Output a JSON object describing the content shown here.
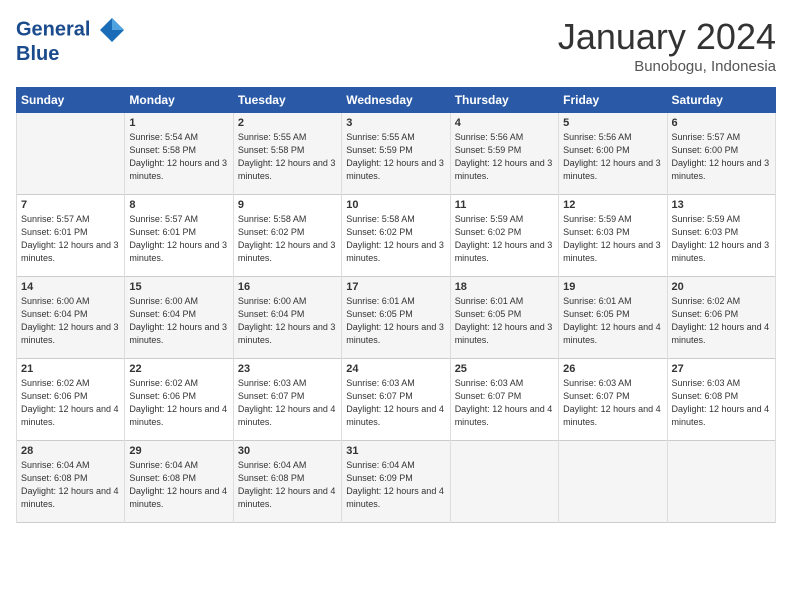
{
  "logo": {
    "line1": "General",
    "line2": "Blue"
  },
  "title": "January 2024",
  "location": "Bunobogu, Indonesia",
  "days_header": [
    "Sunday",
    "Monday",
    "Tuesday",
    "Wednesday",
    "Thursday",
    "Friday",
    "Saturday"
  ],
  "weeks": [
    [
      {
        "day": "",
        "sunrise": "",
        "sunset": "",
        "daylight": ""
      },
      {
        "day": "1",
        "sunrise": "Sunrise: 5:54 AM",
        "sunset": "Sunset: 5:58 PM",
        "daylight": "Daylight: 12 hours and 3 minutes."
      },
      {
        "day": "2",
        "sunrise": "Sunrise: 5:55 AM",
        "sunset": "Sunset: 5:58 PM",
        "daylight": "Daylight: 12 hours and 3 minutes."
      },
      {
        "day": "3",
        "sunrise": "Sunrise: 5:55 AM",
        "sunset": "Sunset: 5:59 PM",
        "daylight": "Daylight: 12 hours and 3 minutes."
      },
      {
        "day": "4",
        "sunrise": "Sunrise: 5:56 AM",
        "sunset": "Sunset: 5:59 PM",
        "daylight": "Daylight: 12 hours and 3 minutes."
      },
      {
        "day": "5",
        "sunrise": "Sunrise: 5:56 AM",
        "sunset": "Sunset: 6:00 PM",
        "daylight": "Daylight: 12 hours and 3 minutes."
      },
      {
        "day": "6",
        "sunrise": "Sunrise: 5:57 AM",
        "sunset": "Sunset: 6:00 PM",
        "daylight": "Daylight: 12 hours and 3 minutes."
      }
    ],
    [
      {
        "day": "7",
        "sunrise": "Sunrise: 5:57 AM",
        "sunset": "Sunset: 6:01 PM",
        "daylight": "Daylight: 12 hours and 3 minutes."
      },
      {
        "day": "8",
        "sunrise": "Sunrise: 5:57 AM",
        "sunset": "Sunset: 6:01 PM",
        "daylight": "Daylight: 12 hours and 3 minutes."
      },
      {
        "day": "9",
        "sunrise": "Sunrise: 5:58 AM",
        "sunset": "Sunset: 6:02 PM",
        "daylight": "Daylight: 12 hours and 3 minutes."
      },
      {
        "day": "10",
        "sunrise": "Sunrise: 5:58 AM",
        "sunset": "Sunset: 6:02 PM",
        "daylight": "Daylight: 12 hours and 3 minutes."
      },
      {
        "day": "11",
        "sunrise": "Sunrise: 5:59 AM",
        "sunset": "Sunset: 6:02 PM",
        "daylight": "Daylight: 12 hours and 3 minutes."
      },
      {
        "day": "12",
        "sunrise": "Sunrise: 5:59 AM",
        "sunset": "Sunset: 6:03 PM",
        "daylight": "Daylight: 12 hours and 3 minutes."
      },
      {
        "day": "13",
        "sunrise": "Sunrise: 5:59 AM",
        "sunset": "Sunset: 6:03 PM",
        "daylight": "Daylight: 12 hours and 3 minutes."
      }
    ],
    [
      {
        "day": "14",
        "sunrise": "Sunrise: 6:00 AM",
        "sunset": "Sunset: 6:04 PM",
        "daylight": "Daylight: 12 hours and 3 minutes."
      },
      {
        "day": "15",
        "sunrise": "Sunrise: 6:00 AM",
        "sunset": "Sunset: 6:04 PM",
        "daylight": "Daylight: 12 hours and 3 minutes."
      },
      {
        "day": "16",
        "sunrise": "Sunrise: 6:00 AM",
        "sunset": "Sunset: 6:04 PM",
        "daylight": "Daylight: 12 hours and 3 minutes."
      },
      {
        "day": "17",
        "sunrise": "Sunrise: 6:01 AM",
        "sunset": "Sunset: 6:05 PM",
        "daylight": "Daylight: 12 hours and 3 minutes."
      },
      {
        "day": "18",
        "sunrise": "Sunrise: 6:01 AM",
        "sunset": "Sunset: 6:05 PM",
        "daylight": "Daylight: 12 hours and 3 minutes."
      },
      {
        "day": "19",
        "sunrise": "Sunrise: 6:01 AM",
        "sunset": "Sunset: 6:05 PM",
        "daylight": "Daylight: 12 hours and 4 minutes."
      },
      {
        "day": "20",
        "sunrise": "Sunrise: 6:02 AM",
        "sunset": "Sunset: 6:06 PM",
        "daylight": "Daylight: 12 hours and 4 minutes."
      }
    ],
    [
      {
        "day": "21",
        "sunrise": "Sunrise: 6:02 AM",
        "sunset": "Sunset: 6:06 PM",
        "daylight": "Daylight: 12 hours and 4 minutes."
      },
      {
        "day": "22",
        "sunrise": "Sunrise: 6:02 AM",
        "sunset": "Sunset: 6:06 PM",
        "daylight": "Daylight: 12 hours and 4 minutes."
      },
      {
        "day": "23",
        "sunrise": "Sunrise: 6:03 AM",
        "sunset": "Sunset: 6:07 PM",
        "daylight": "Daylight: 12 hours and 4 minutes."
      },
      {
        "day": "24",
        "sunrise": "Sunrise: 6:03 AM",
        "sunset": "Sunset: 6:07 PM",
        "daylight": "Daylight: 12 hours and 4 minutes."
      },
      {
        "day": "25",
        "sunrise": "Sunrise: 6:03 AM",
        "sunset": "Sunset: 6:07 PM",
        "daylight": "Daylight: 12 hours and 4 minutes."
      },
      {
        "day": "26",
        "sunrise": "Sunrise: 6:03 AM",
        "sunset": "Sunset: 6:07 PM",
        "daylight": "Daylight: 12 hours and 4 minutes."
      },
      {
        "day": "27",
        "sunrise": "Sunrise: 6:03 AM",
        "sunset": "Sunset: 6:08 PM",
        "daylight": "Daylight: 12 hours and 4 minutes."
      }
    ],
    [
      {
        "day": "28",
        "sunrise": "Sunrise: 6:04 AM",
        "sunset": "Sunset: 6:08 PM",
        "daylight": "Daylight: 12 hours and 4 minutes."
      },
      {
        "day": "29",
        "sunrise": "Sunrise: 6:04 AM",
        "sunset": "Sunset: 6:08 PM",
        "daylight": "Daylight: 12 hours and 4 minutes."
      },
      {
        "day": "30",
        "sunrise": "Sunrise: 6:04 AM",
        "sunset": "Sunset: 6:08 PM",
        "daylight": "Daylight: 12 hours and 4 minutes."
      },
      {
        "day": "31",
        "sunrise": "Sunrise: 6:04 AM",
        "sunset": "Sunset: 6:09 PM",
        "daylight": "Daylight: 12 hours and 4 minutes."
      },
      {
        "day": "",
        "sunrise": "",
        "sunset": "",
        "daylight": ""
      },
      {
        "day": "",
        "sunrise": "",
        "sunset": "",
        "daylight": ""
      },
      {
        "day": "",
        "sunrise": "",
        "sunset": "",
        "daylight": ""
      }
    ]
  ]
}
